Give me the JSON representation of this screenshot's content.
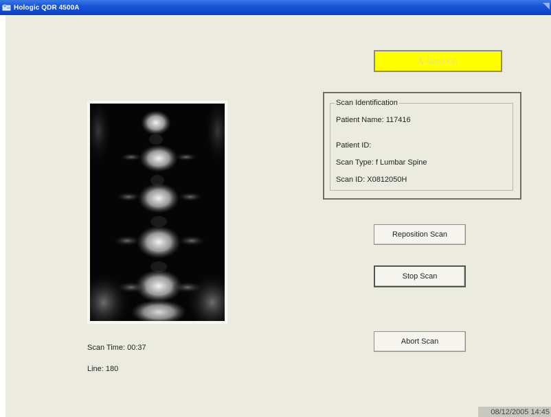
{
  "window": {
    "title": "Hologic QDR 4500A",
    "icon": "app-icon"
  },
  "xray_status": {
    "label": "X-Rays On",
    "color": "#ffff00"
  },
  "scan_identification": {
    "legend": "Scan Identification",
    "patient_name": "Patient Name: 117416",
    "patient_id": "Patient ID:",
    "scan_type": "Scan Type: f Lumbar Spine",
    "scan_id": "Scan ID: X0812050H"
  },
  "buttons": {
    "reposition": "Reposition Scan",
    "stop": "Stop Scan",
    "abort": "Abort Scan"
  },
  "status": {
    "scan_time": "Scan Time: 00:37",
    "line": "Line: 180"
  },
  "datetime": "08/12/2005 14:45"
}
